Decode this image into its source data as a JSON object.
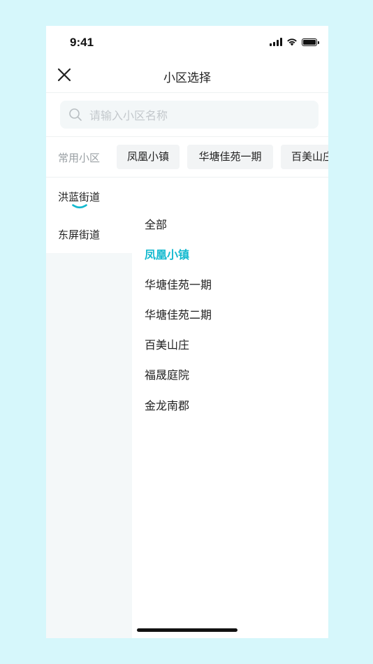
{
  "status_bar": {
    "time": "9:41"
  },
  "nav": {
    "title": "小区选择",
    "close_icon": "close-icon"
  },
  "search": {
    "placeholder": "请输入小区名称",
    "value": "",
    "icon": "search-icon"
  },
  "common": {
    "label": "常用小区",
    "chips": [
      "凤凰小镇",
      "华塘佳苑一期",
      "百美山庄"
    ]
  },
  "districts": {
    "items": [
      {
        "label": "洪蓝街道",
        "active": true
      },
      {
        "label": "东屏街道",
        "active": false
      }
    ]
  },
  "communities": {
    "items": [
      {
        "label": "全部"
      },
      {
        "label": "凤凰小镇",
        "selected": true
      },
      {
        "label": "华塘佳苑一期"
      },
      {
        "label": "华塘佳苑二期"
      },
      {
        "label": "百美山庄"
      },
      {
        "label": "福晟庭院"
      },
      {
        "label": "金龙南郡"
      }
    ]
  },
  "colors": {
    "background": "#d6f7fb",
    "accent": "#13b9cf",
    "sidebar_bg": "#f4f8f9",
    "chip_bg": "#f2f4f5"
  }
}
